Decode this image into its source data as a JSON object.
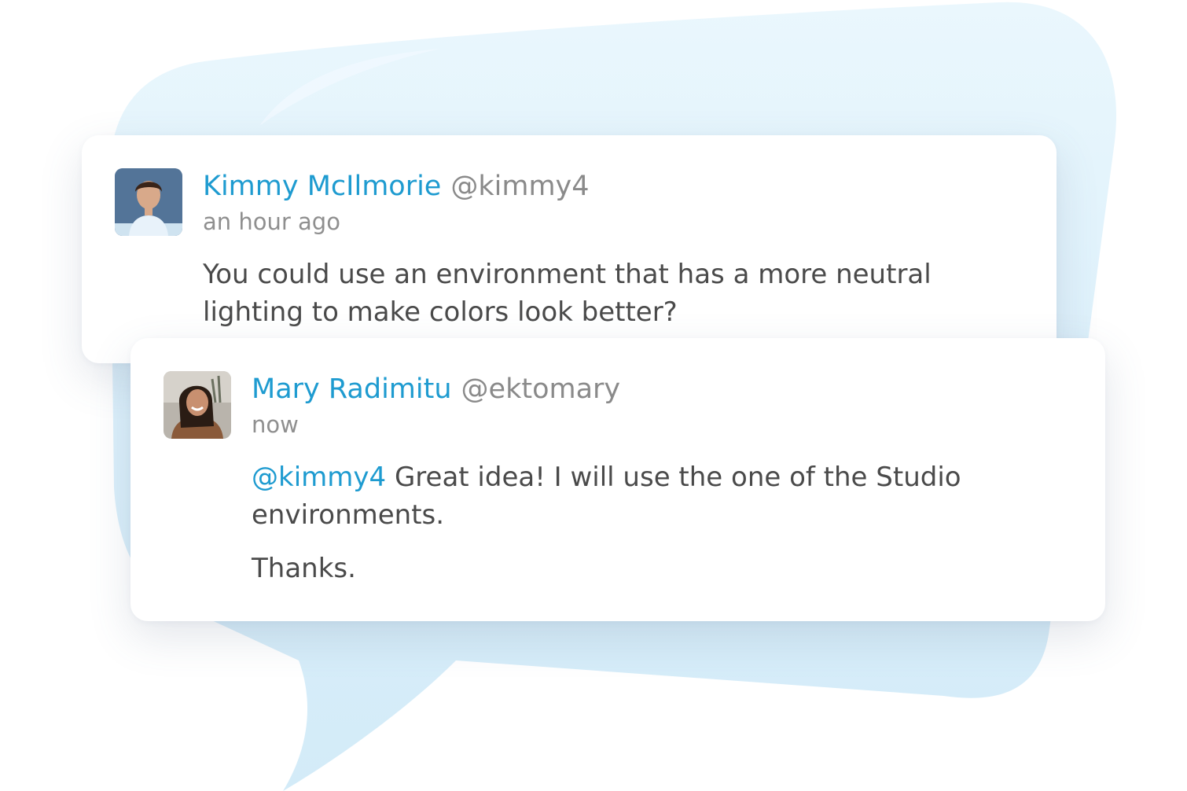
{
  "comments": [
    {
      "name": "Kimmy McIlmorie",
      "handle": "@kimmy4",
      "time": "an hour ago",
      "text": "You could use an environment that has a more neutral lighting to make colors look better?"
    },
    {
      "name": "Mary Radimitu",
      "handle": "@ektomary",
      "time": "now",
      "mention": "@kimmy4",
      "text": " Great idea! I will use the one of the Studio environments.",
      "text2": "Thanks."
    }
  ],
  "colors": {
    "accent": "#1e9bd0",
    "bubble": "#dcf0fb",
    "muted": "#8a8a8a",
    "text": "#4a4a4a"
  }
}
